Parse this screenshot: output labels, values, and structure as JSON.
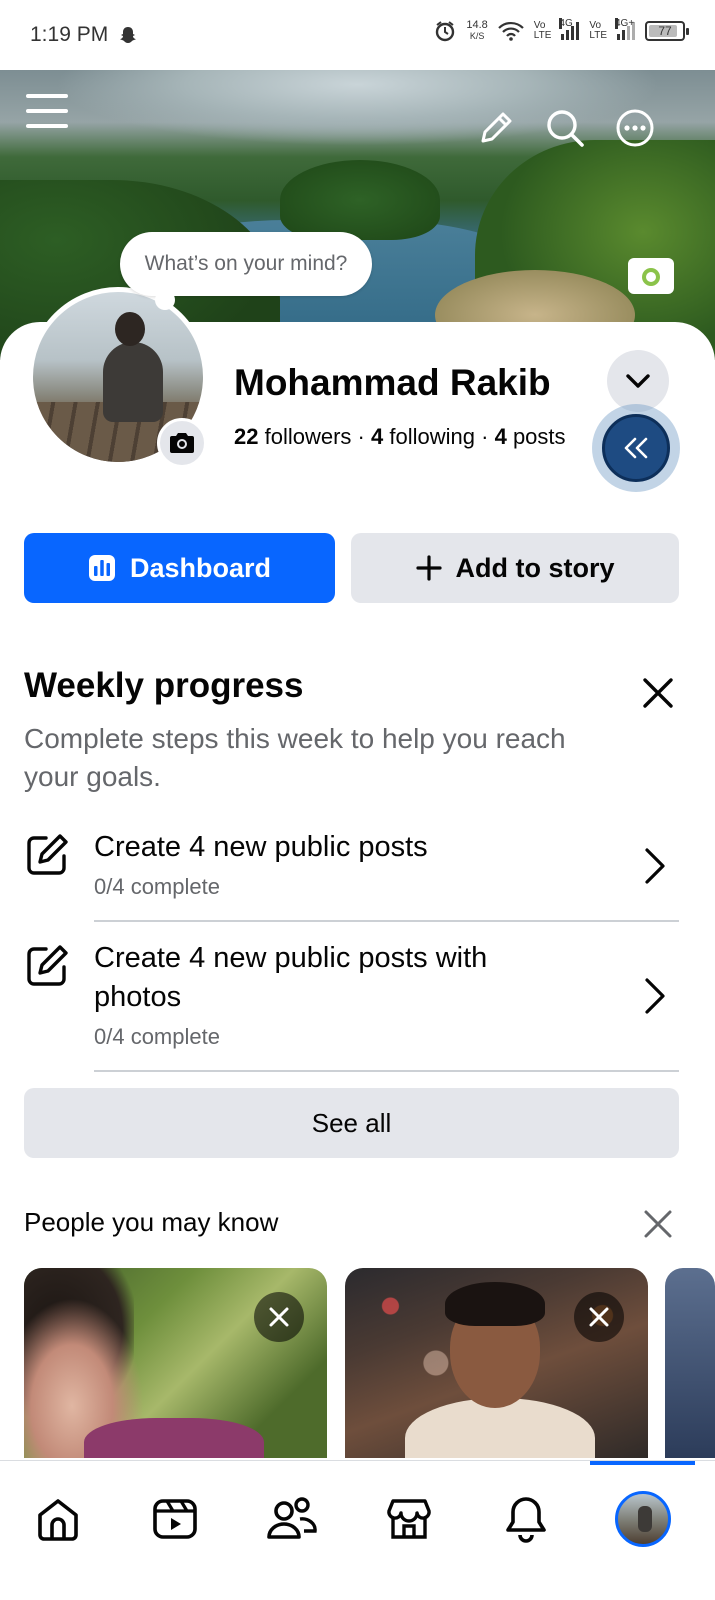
{
  "status_bar": {
    "time": "1:19 PM",
    "net_speed_value": "14.8",
    "net_speed_unit": "K/S",
    "sim1_label": "Vo",
    "sim1_sub": "LTE",
    "sim1_net": "4G",
    "sim2_label": "Vo",
    "sim2_sub": "LTE",
    "sim2_net": "4G+",
    "battery": "77"
  },
  "cover": {
    "mind_prompt": "What’s on your mind?"
  },
  "profile": {
    "name": "Mohammad Rakib",
    "followers_count": "22",
    "followers_label": "followers",
    "following_count": "4",
    "following_label": "following",
    "posts_count": "4",
    "posts_label": "posts",
    "separator": "·"
  },
  "actions": {
    "dashboard_label": "Dashboard",
    "add_story_label": "Add to story"
  },
  "weekly_progress": {
    "title": "Weekly progress",
    "subtitle": "Complete steps this week to help you reach your goals.",
    "tasks": [
      {
        "title": "Create 4 new public posts",
        "progress": "0/4 complete"
      },
      {
        "title": "Create 4 new public posts with photos",
        "progress": "0/4 complete"
      }
    ],
    "see_all_label": "See all"
  },
  "people_you_may_know": {
    "title": "People you may know"
  },
  "colors": {
    "brand_blue": "#0866ff",
    "secondary_bg": "#e4e6eb",
    "secondary_text": "#65676b"
  },
  "icons": {
    "menu": "hamburger-menu-icon",
    "edit": "pencil-icon",
    "search": "search-icon",
    "more": "more-icon",
    "camera": "camera-icon",
    "home": "home-icon",
    "video": "video-icon",
    "friends": "friends-icon",
    "marketplace": "marketplace-icon",
    "notifications": "bell-icon"
  }
}
